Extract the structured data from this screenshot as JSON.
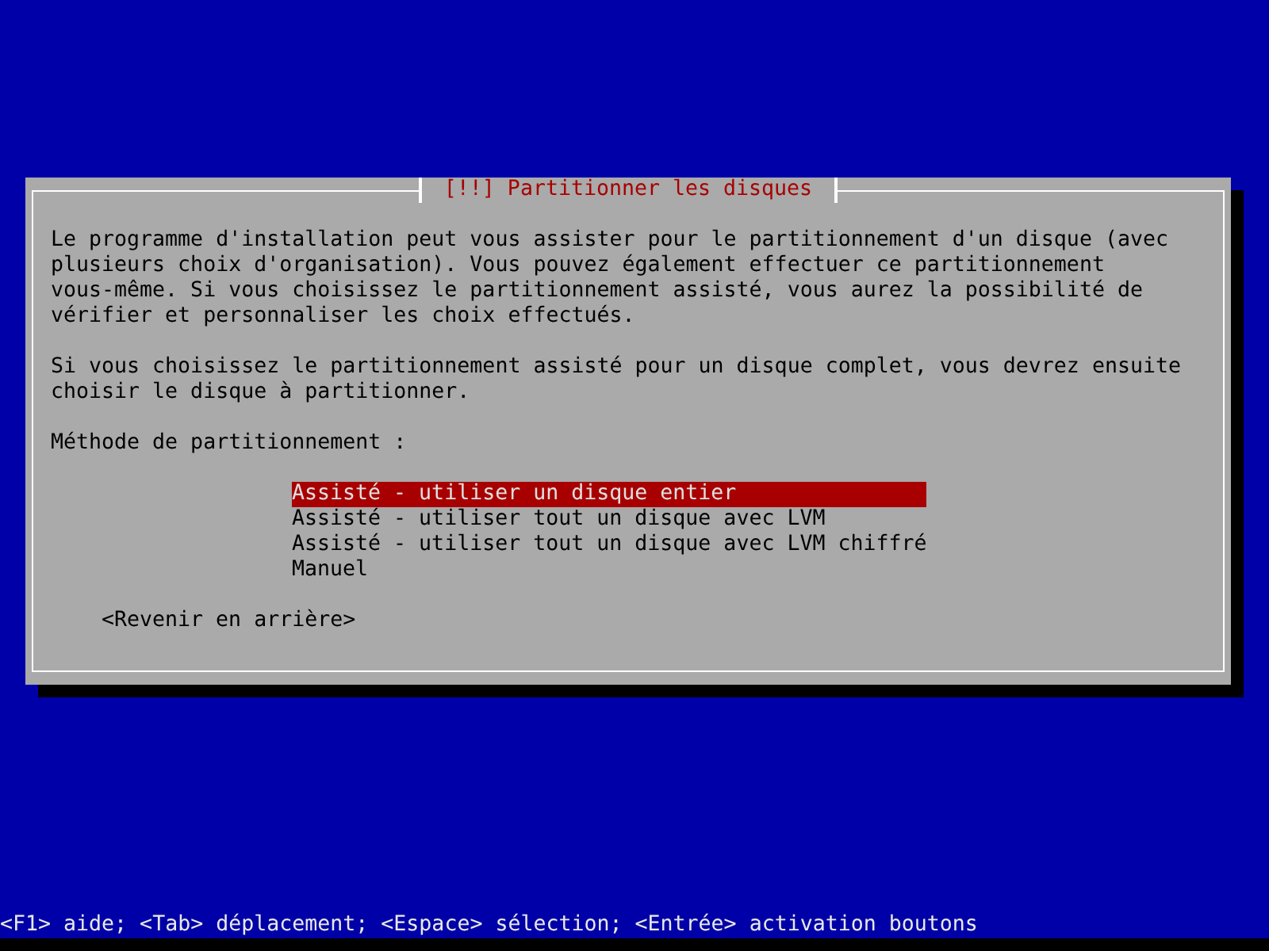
{
  "dialog": {
    "title": "[!!] Partitionner les disques",
    "paragraphs": [
      "Le programme d'installation peut vous assister pour le partitionnement d'un disque (avec\nplusieurs choix d'organisation). Vous pouvez également effectuer ce partitionnement\nvous-même. Si vous choisissez le partitionnement assisté, vous aurez la possibilité de\nvérifier et personnaliser les choix effectués.",
      "Si vous choisissez le partitionnement assisté pour un disque complet, vous devrez ensuite\nchoisir le disque à partitionner."
    ],
    "prompt": "Méthode de partitionnement :",
    "options": [
      {
        "label": "Assisté - utiliser un disque entier",
        "selected": true
      },
      {
        "label": "Assisté - utiliser tout un disque avec LVM",
        "selected": false
      },
      {
        "label": "Assisté - utiliser tout un disque avec LVM chiffré",
        "selected": false
      },
      {
        "label": "Manuel",
        "selected": false
      }
    ],
    "back_button": "<Revenir en arrière>"
  },
  "status_bar": "<F1> aide; <Tab> déplacement; <Espace> sélection; <Entrée> activation boutons"
}
